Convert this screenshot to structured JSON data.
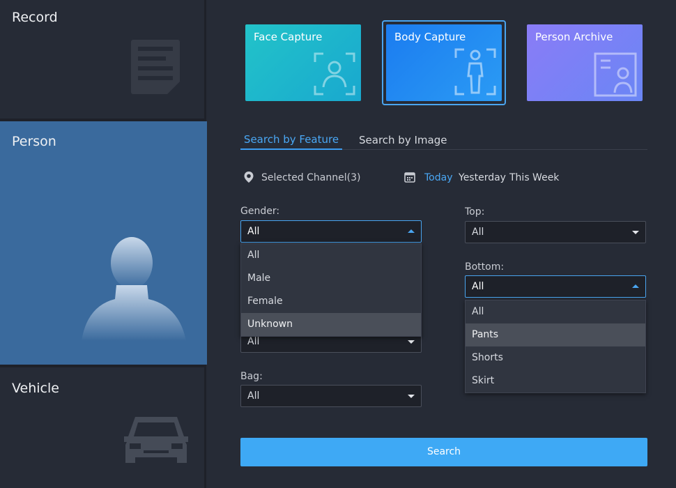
{
  "sidebar": {
    "items": [
      {
        "label": "Record"
      },
      {
        "label": "Person"
      },
      {
        "label": "Vehicle"
      }
    ],
    "active": "Person"
  },
  "cards": [
    {
      "label": "Face Capture",
      "icon": "face-frame-icon"
    },
    {
      "label": "Body Capture",
      "icon": "body-frame-icon",
      "selected": true
    },
    {
      "label": "Person Archive",
      "icon": "archive-card-icon"
    }
  ],
  "tabs": [
    {
      "label": "Search by Feature",
      "active": true
    },
    {
      "label": "Search by Image"
    }
  ],
  "filters": {
    "channel": "Selected Channel(3)",
    "dates": [
      "Today",
      "Yesterday",
      "This Week"
    ],
    "active_date": "Today"
  },
  "fields": {
    "gender": {
      "label": "Gender:",
      "value": "All",
      "options": [
        "All",
        "Male",
        "Female",
        "Unknown"
      ],
      "highlighted": "Unknown"
    },
    "hidden_field": {
      "value": "All"
    },
    "bag": {
      "label": "Bag:",
      "value": "All"
    },
    "top": {
      "label": "Top:",
      "value": "All"
    },
    "bottom": {
      "label": "Bottom:",
      "value": "All",
      "options": [
        "All",
        "Pants",
        "Shorts",
        "Skirt"
      ],
      "highlighted": "Pants"
    }
  },
  "search_button": "Search",
  "colors": {
    "accent": "#3ea9f5",
    "active_nav": "#3a6a9d"
  }
}
